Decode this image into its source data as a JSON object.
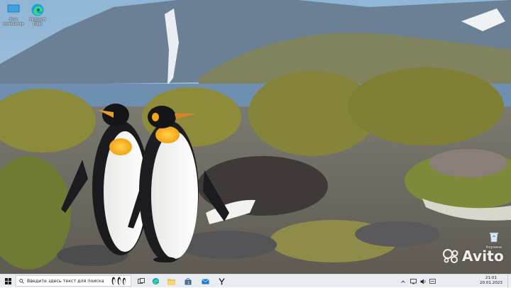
{
  "desktop": {
    "icons": [
      {
        "label": "Этот компьютер",
        "icon": "this-pc-icon"
      },
      {
        "label": "Microsoft Edge",
        "icon": "edge-icon"
      }
    ],
    "recycle_bin": {
      "label": "Корзина",
      "icon": "recycle-bin-icon"
    },
    "watermark": {
      "text": "Avito"
    }
  },
  "taskbar": {
    "search_placeholder": "Введите здесь текст для поиска",
    "pinned": [
      "task-view-icon",
      "edge-icon",
      "file-explorer-icon",
      "microsoft-store-icon",
      "mail-icon",
      "yandex-browser-icon"
    ],
    "clock": {
      "time": "21:01",
      "date": "20.01.2023"
    }
  },
  "colors": {
    "taskbar_bg": "#e9edf2",
    "accent": "#0078d4"
  }
}
